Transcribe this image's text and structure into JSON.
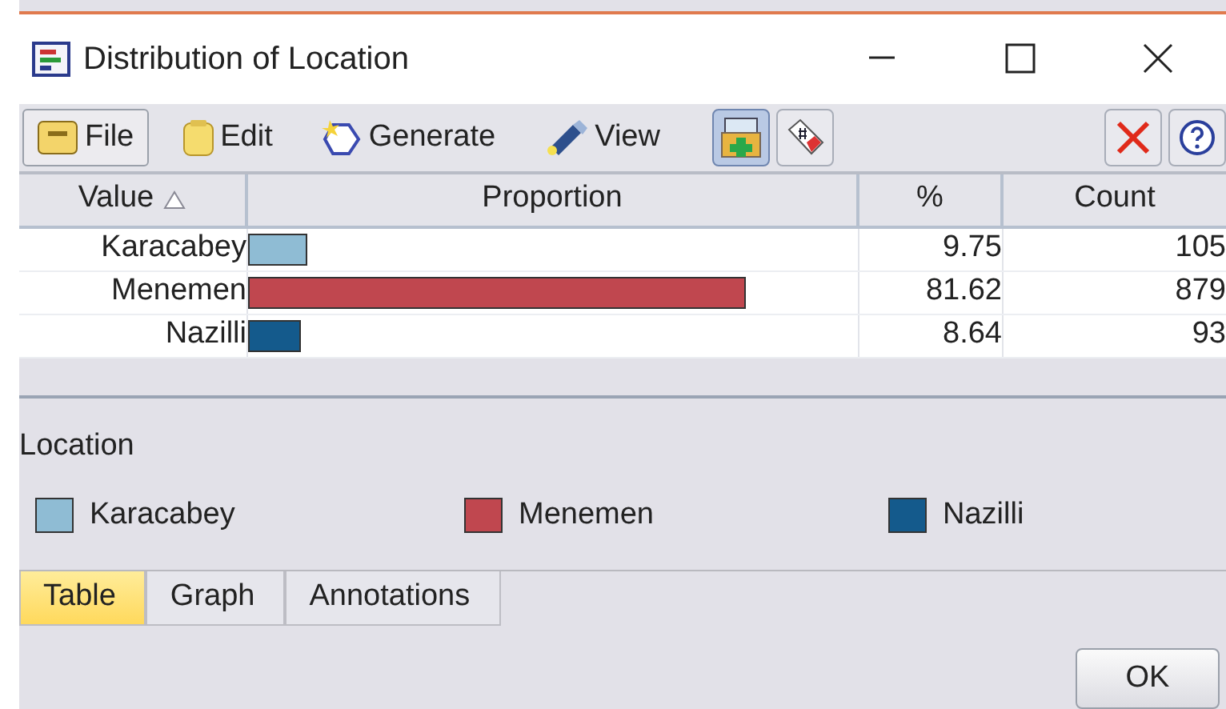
{
  "window": {
    "title": "Distribution of Location"
  },
  "toolbar": [
    {
      "kind": "menu",
      "label": "File",
      "framed": true
    },
    {
      "kind": "menu",
      "label": "Edit",
      "framed": false
    },
    {
      "kind": "menu",
      "label": "Generate",
      "framed": false
    },
    {
      "kind": "menu",
      "label": "View",
      "framed": false
    },
    {
      "kind": "toggle",
      "selected": true
    },
    {
      "kind": "toggle",
      "selected": false
    },
    {
      "kind": "spacer"
    },
    {
      "kind": "action"
    },
    {
      "kind": "action"
    }
  ],
  "table": {
    "columns": [
      {
        "label": "Value",
        "sorted": true
      },
      {
        "label": "Proportion",
        "sorted": false
      },
      {
        "label": "%",
        "sorted": false
      },
      {
        "label": "Count",
        "sorted": false
      }
    ],
    "rows": [
      {
        "value": "Karacabey",
        "level": 0.0975,
        "color": "#8fbcd4",
        "percent": "9.75",
        "count": "105"
      },
      {
        "value": "Menemen",
        "level": 0.8162,
        "color": "#c0474f",
        "percent": "81.62",
        "count": "879"
      },
      {
        "value": "Nazilli",
        "level": 0.0864,
        "color": "#145a8c",
        "percent": "8.64",
        "count": "93"
      }
    ]
  },
  "legend": {
    "title": "Location",
    "items": [
      {
        "label": "Karacabey",
        "color": "#8fbcd4"
      },
      {
        "label": "Menemen",
        "color": "#c0474f"
      },
      {
        "label": "Nazilli",
        "color": "#145a8c"
      }
    ]
  },
  "tabs": [
    {
      "label": "Table",
      "selected": true
    },
    {
      "label": "Graph",
      "selected": false
    },
    {
      "label": "Annotations",
      "selected": false
    }
  ],
  "buttons": [
    "OK"
  ]
}
